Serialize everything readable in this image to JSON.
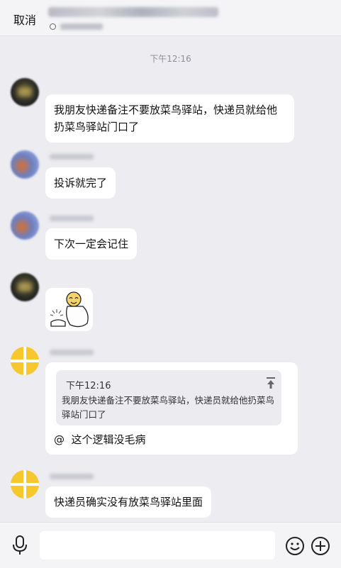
{
  "header": {
    "cancel_label": "取消"
  },
  "chat": {
    "timestamp": "下午12:16",
    "messages": [
      {
        "text": "我朋友快递备注不要放菜鸟驿站，快递员就给他扔菜鸟驿站门口了"
      },
      {
        "text": "投诉就完了"
      },
      {
        "text": "下次一定会记住"
      },
      {
        "sticker": "laughing-figure-sticker"
      },
      {
        "quote_time": "下午12:16",
        "quote_text": "我朋友快递备注不要放菜鸟驿站，快递员就给他扔菜鸟驿站门口了",
        "mention": "@",
        "reply_text": "这个逻辑没毛病"
      },
      {
        "text": "快递员确实没有放菜鸟驿站里面"
      }
    ]
  },
  "input_bar": {
    "icons": [
      "microphone-icon",
      "emoji-icon",
      "plus-icon"
    ]
  }
}
